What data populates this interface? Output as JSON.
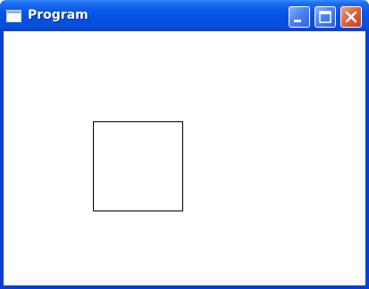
{
  "window": {
    "title": "Program"
  },
  "icons": {
    "window_icon": "window-icon",
    "minimize": "minimize-icon",
    "maximize": "maximize-icon",
    "close": "close-icon"
  },
  "colors": {
    "titlebar": "#0550e0",
    "close_button": "#e0623c",
    "client_background": "#ffffff",
    "square_border": "#000000"
  }
}
